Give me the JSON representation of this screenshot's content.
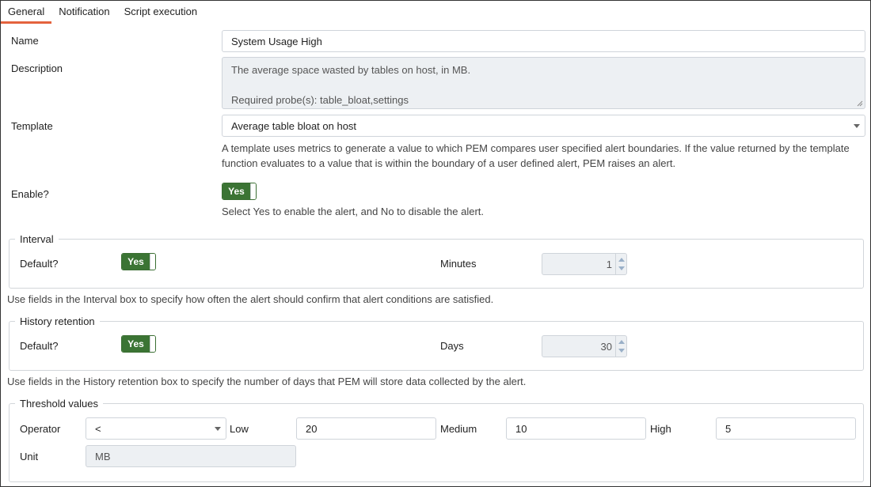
{
  "tabs": [
    {
      "label": "General",
      "active": true
    },
    {
      "label": "Notification",
      "active": false
    },
    {
      "label": "Script execution",
      "active": false
    }
  ],
  "accent_color": "#e4633e",
  "toggle_color": "#3b7434",
  "general": {
    "name_label": "Name",
    "name_value": "System Usage High",
    "description_label": "Description",
    "description_value": "The average space wasted by tables on host, in MB.\n\nRequired probe(s): table_bloat,settings",
    "template_label": "Template",
    "template_value": "Average table bloat on host",
    "template_help": "A template uses metrics to generate a value to which PEM compares user specified alert boundaries. If the value returned by the template function evaluates to a value that is within the boundary of a user defined alert, PEM raises an alert.",
    "enable_label": "Enable?",
    "enable_value": "Yes",
    "enable_help": "Select Yes to enable the alert, and No to disable the alert."
  },
  "interval": {
    "legend": "Interval",
    "default_label": "Default?",
    "default_value": "Yes",
    "minutes_label": "Minutes",
    "minutes_value": "1",
    "help": "Use fields in the Interval box to specify how often the alert should confirm that alert conditions are satisfied."
  },
  "history": {
    "legend": "History retention",
    "default_label": "Default?",
    "default_value": "Yes",
    "days_label": "Days",
    "days_value": "30",
    "help": "Use fields in the History retention box to specify the number of days that PEM will store data collected by the alert."
  },
  "threshold": {
    "legend": "Threshold values",
    "operator_label": "Operator",
    "operator_value": "<",
    "low_label": "Low",
    "low_value": "20",
    "medium_label": "Medium",
    "medium_value": "10",
    "high_label": "High",
    "high_value": "5",
    "unit_label": "Unit",
    "unit_value": "MB"
  }
}
